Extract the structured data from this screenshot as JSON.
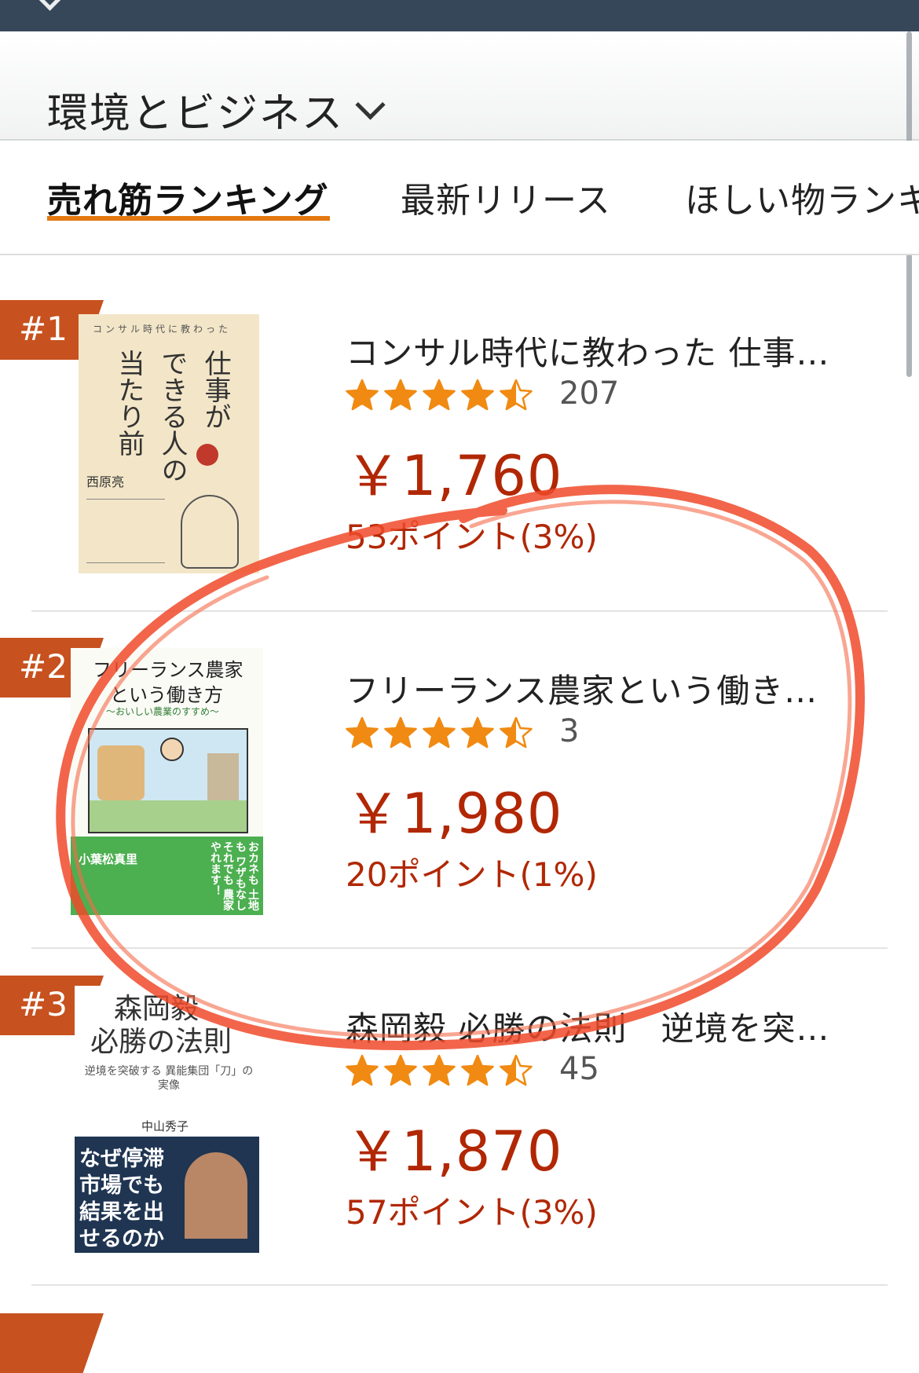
{
  "header": {
    "category_title": "環境とビジネス",
    "chevron_icon": "chevron-down-icon"
  },
  "tabs": [
    {
      "label": "売れ筋ランキング",
      "active": true
    },
    {
      "label": "最新リリース",
      "active": false
    },
    {
      "label": "ほしい物ランキ",
      "active": false
    }
  ],
  "products": [
    {
      "rank": "#1",
      "title": "コンサル時代に教わった 仕事…",
      "rating_stars": 4.5,
      "review_count": "207",
      "price": "￥1,760",
      "points": "53ポイント(3%)",
      "cover": {
        "top_line": "コンサル時代に教わった",
        "title_lines": [
          "仕事が",
          "できる人の",
          "当たり前"
        ],
        "author": "西原亮"
      }
    },
    {
      "rank": "#2",
      "title": "フリーランス農家という働き…",
      "rating_stars": 4.5,
      "review_count": "3",
      "price": "￥1,980",
      "points": "20ポイント(1%)",
      "cover": {
        "title_lines": [
          "フリーランス農家",
          "という働き方"
        ],
        "subtitle": "～おいしい農業のすすめ～",
        "author": "小葉松真里",
        "tagline": "おカネも 土地も ワザもなし それでも 農家やれます！"
      }
    },
    {
      "rank": "#3",
      "title": "森岡毅 必勝の法則　逆境を突…",
      "rating_stars": 4.5,
      "review_count": "45",
      "price": "￥1,870",
      "points": "57ポイント(3%)",
      "cover": {
        "title_lines": [
          "森岡毅",
          "必勝の法則"
        ],
        "subtitle": "逆境を突破する 異能集団「刀」の実像",
        "author": "中山秀子",
        "banner": "なぜ停滞市場でも結果を出せるのか"
      }
    }
  ],
  "colors": {
    "topbar": "#37475a",
    "badge": "#c7511f",
    "tab_underline": "#e47911",
    "price": "#b12704",
    "star": "#f08a12",
    "annotation": "#f04a2a"
  }
}
